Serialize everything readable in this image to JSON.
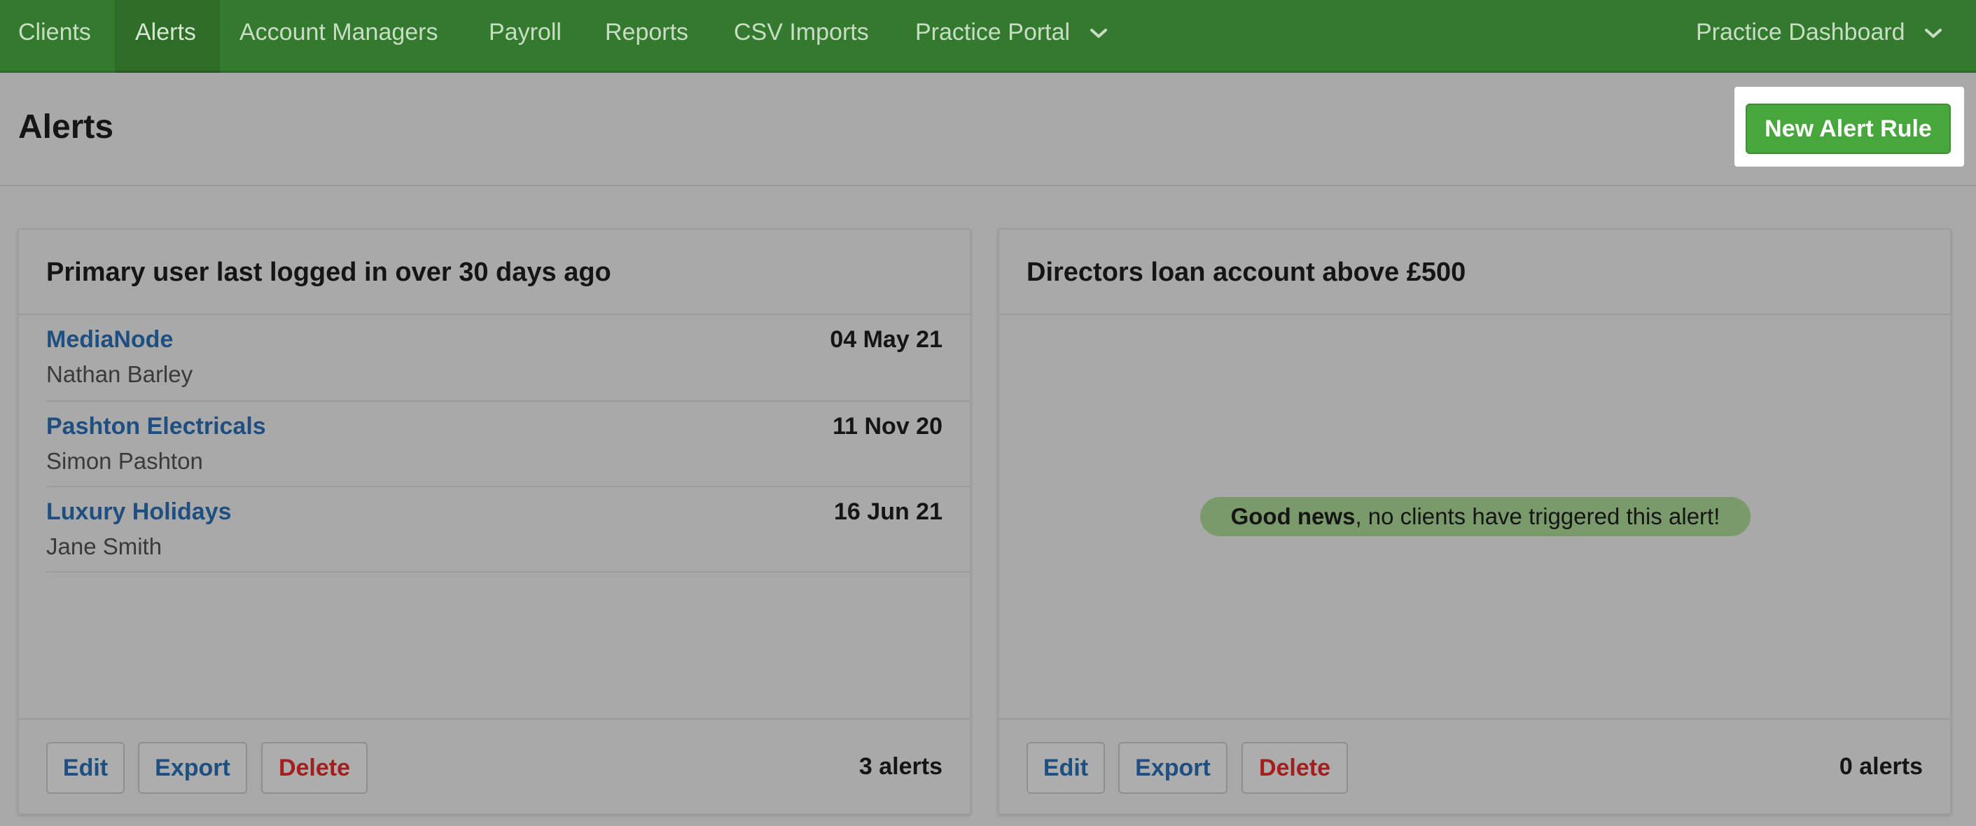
{
  "nav": {
    "items": [
      {
        "label": "Clients",
        "active": false
      },
      {
        "label": "Alerts",
        "active": true
      },
      {
        "label": "Account Managers",
        "active": false
      },
      {
        "label": "Payroll",
        "active": false
      },
      {
        "label": "Reports",
        "active": false
      },
      {
        "label": "CSV Imports",
        "active": false
      },
      {
        "label": "Practice Portal",
        "active": false,
        "dropdown": true
      }
    ],
    "right_item": {
      "label": "Practice Dashboard",
      "dropdown": true
    }
  },
  "page": {
    "title": "Alerts",
    "new_rule_button": "New Alert Rule"
  },
  "panels": [
    {
      "title": "Primary user last logged in over 30 days ago",
      "rows": [
        {
          "client": "MediaNode",
          "person": "Nathan Barley",
          "date": "04 May 21"
        },
        {
          "client": "Pashton Electricals",
          "person": "Simon Pashton",
          "date": "11 Nov 20"
        },
        {
          "client": "Luxury Holidays",
          "person": "Jane Smith",
          "date": "16 Jun 21"
        }
      ],
      "buttons": {
        "edit": "Edit",
        "export": "Export",
        "delete": "Delete"
      },
      "count": "3 alerts"
    },
    {
      "title": "Directors loan account above £500",
      "rows": [],
      "empty": {
        "bold": "Good news",
        "rest": ", no clients have triggered this alert!"
      },
      "buttons": {
        "edit": "Edit",
        "export": "Export",
        "delete": "Delete"
      },
      "count": "0 alerts"
    }
  ],
  "icons": {
    "dropdown": "chevron-down-icon"
  },
  "colors": {
    "nav_bg": "#347a2e",
    "primary_button": "#48a73c",
    "link_blue": "#1f4f80",
    "delete_red": "#a31e1e",
    "good_news_bg": "#7a9a6c"
  }
}
